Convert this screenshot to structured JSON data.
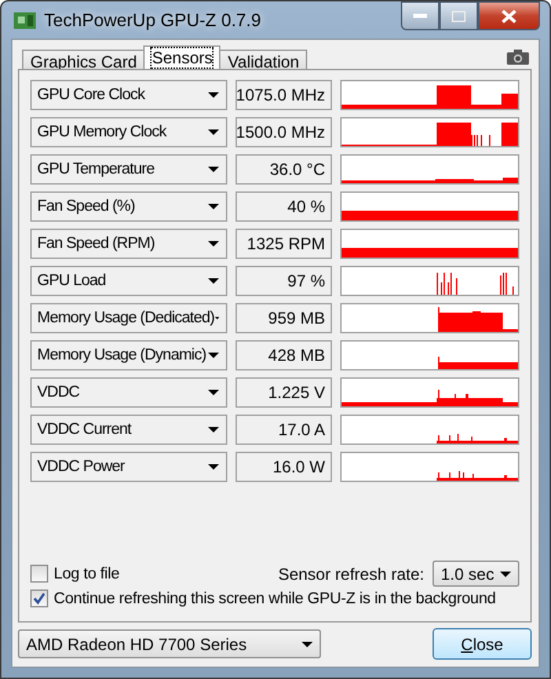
{
  "window": {
    "title": "TechPowerUp GPU-Z 0.7.9"
  },
  "tabs": [
    {
      "label": "Graphics Card",
      "selected": false
    },
    {
      "label": "Sensors",
      "selected": true
    },
    {
      "label": "Validation",
      "selected": false
    }
  ],
  "sensors": [
    {
      "name": "GPU Core Clock",
      "reading": "1075.0 MHz"
    },
    {
      "name": "GPU Memory Clock",
      "reading": "1500.0 MHz"
    },
    {
      "name": "GPU Temperature",
      "reading": "36.0 °C"
    },
    {
      "name": "Fan Speed (%)",
      "reading": "40 %"
    },
    {
      "name": "Fan Speed (RPM)",
      "reading": "1325 RPM"
    },
    {
      "name": "GPU Load",
      "reading": "97 %"
    },
    {
      "name": "Memory Usage (Dedicated)",
      "reading": "959 MB"
    },
    {
      "name": "Memory Usage (Dynamic)",
      "reading": "428 MB"
    },
    {
      "name": "VDDC",
      "reading": "1.225 V"
    },
    {
      "name": "VDDC Current",
      "reading": "17.0 A"
    },
    {
      "name": "VDDC Power",
      "reading": "16.0 W"
    }
  ],
  "options": [
    {
      "label": "Log to file",
      "checked": false
    },
    {
      "label": "Continue refreshing this screen while GPU-Z is in the background",
      "checked": true
    }
  ],
  "refresh_rate": {
    "label": "Sensor refresh rate:",
    "value": "1.0 sec"
  },
  "gpu_select": {
    "value": "AMD Radeon HD 7700 Series"
  },
  "close_button": {
    "label": "Close"
  }
}
